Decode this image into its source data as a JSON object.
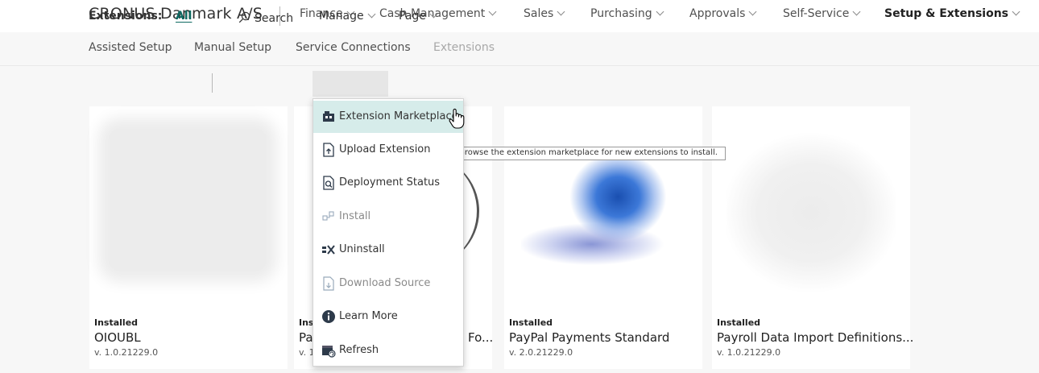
{
  "app": {
    "company": "CRONUS Danmark A/S"
  },
  "top_menu": [
    {
      "label": "Finance"
    },
    {
      "label": "Cash Management"
    },
    {
      "label": "Sales"
    },
    {
      "label": "Purchasing"
    },
    {
      "label": "Approvals"
    },
    {
      "label": "Self-Service"
    },
    {
      "label": "Setup & Extensions"
    }
  ],
  "sub_nav": [
    {
      "label": "Assisted Setup"
    },
    {
      "label": "Manual Setup"
    },
    {
      "label": "Service Connections"
    },
    {
      "label": "Extensions"
    }
  ],
  "action_bar": {
    "title": "Extensions:",
    "filter_all": "All",
    "search": "Search",
    "manage": "Manage",
    "page": "Page"
  },
  "manage_menu": [
    {
      "label": "Extension Marketplace",
      "icon": "marketplace-icon"
    },
    {
      "label": "Upload Extension",
      "icon": "upload-icon"
    },
    {
      "label": "Deployment Status",
      "icon": "deployment-status-icon"
    },
    {
      "label": "Install",
      "icon": "install-icon"
    },
    {
      "label": "Uninstall",
      "icon": "uninstall-icon"
    },
    {
      "label": "Download Source",
      "icon": "download-source-icon"
    },
    {
      "label": "Learn More",
      "icon": "info-icon"
    },
    {
      "label": "Refresh",
      "icon": "refresh-icon"
    }
  ],
  "tooltip": "Browse the extension marketplace for new extensions to install.",
  "cards": [
    {
      "status": "Installed",
      "name": "OIOUBL",
      "version": "v. 1.0.21229.0"
    },
    {
      "status": "Ins",
      "name": "Pa",
      "name_tail": "Fo...",
      "version": "v. 1"
    },
    {
      "status": "Installed",
      "name": "PayPal Payments Standard",
      "version": "v. 2.0.21229.0"
    },
    {
      "status": "Installed",
      "name": "Payroll Data Import Definitions...",
      "version": "v. 1.0.21229.0"
    }
  ],
  "colors": {
    "accent": "#0f6a62",
    "menu_hover": "#d6ecea",
    "page_bg": "#f7f7f7"
  }
}
